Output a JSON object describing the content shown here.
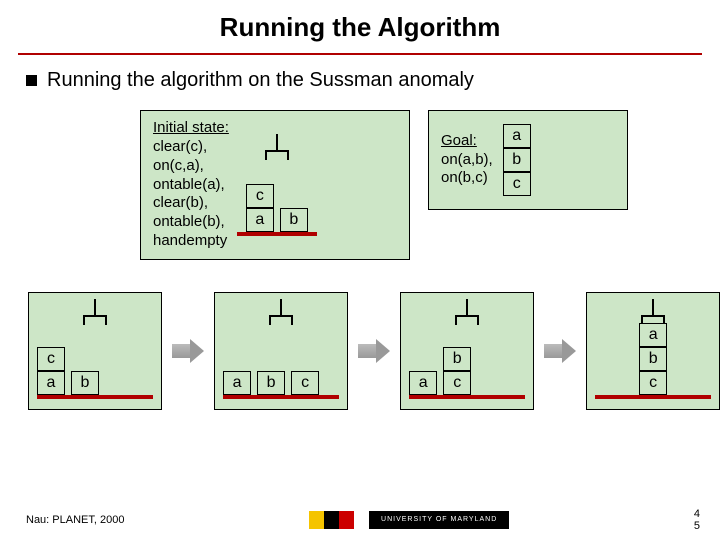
{
  "title": "Running the Algorithm",
  "bullet": "Running the algorithm on the Sussman anomaly",
  "initial": {
    "heading": "Initial state:",
    "predicates": "clear(c),\non(c,a),\nontable(a),\nclear(b),\nontable(b),\nhandempty"
  },
  "goal": {
    "heading": "Goal:",
    "predicates": "on(a,b),\non(b,c)"
  },
  "labels": {
    "a": "a",
    "b": "b",
    "c": "c"
  },
  "footer": {
    "left": "Nau: PLANET, 2000",
    "page1": "4",
    "page2": "5",
    "umd": "UNIVERSITY OF MARYLAND"
  }
}
